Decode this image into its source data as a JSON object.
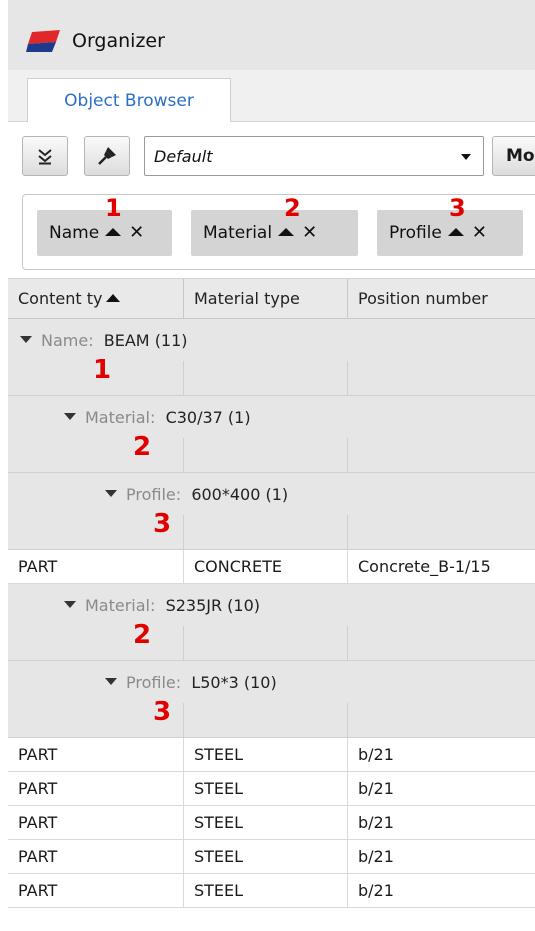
{
  "app": {
    "title": "Organizer"
  },
  "tabs": [
    {
      "label": "Object Browser"
    }
  ],
  "toolbar": {
    "collapse_icon": "double-chevron-down-icon",
    "pin_icon": "pin-icon",
    "view_select_value": "Default",
    "more_label": "Mo"
  },
  "group_by": [
    {
      "label": "Name",
      "order": "1"
    },
    {
      "label": "Material",
      "order": "2"
    },
    {
      "label": "Profile",
      "order": "3"
    }
  ],
  "columns": [
    {
      "label": "Content ty"
    },
    {
      "label": "Material type"
    },
    {
      "label": "Position number"
    }
  ],
  "groups": {
    "g1": {
      "key": "Name:",
      "value": "BEAM (11)",
      "level": "1"
    },
    "g2": {
      "key": "Material:",
      "value": "C30/37 (1)",
      "level": "2"
    },
    "g3": {
      "key": "Profile:",
      "value": "600*400 (1)",
      "level": "3"
    },
    "g4": {
      "key": "Material:",
      "value": "S235JR (10)",
      "level": "2"
    },
    "g5": {
      "key": "Profile:",
      "value": "L50*3 (10)",
      "level": "3"
    }
  },
  "rows": [
    [
      "PART",
      "CONCRETE",
      "Concrete_B-1/15"
    ],
    [
      "PART",
      "STEEL",
      "b/21"
    ],
    [
      "PART",
      "STEEL",
      "b/21"
    ],
    [
      "PART",
      "STEEL",
      "b/21"
    ],
    [
      "PART",
      "STEEL",
      "b/21"
    ],
    [
      "PART",
      "STEEL",
      "b/21"
    ]
  ]
}
